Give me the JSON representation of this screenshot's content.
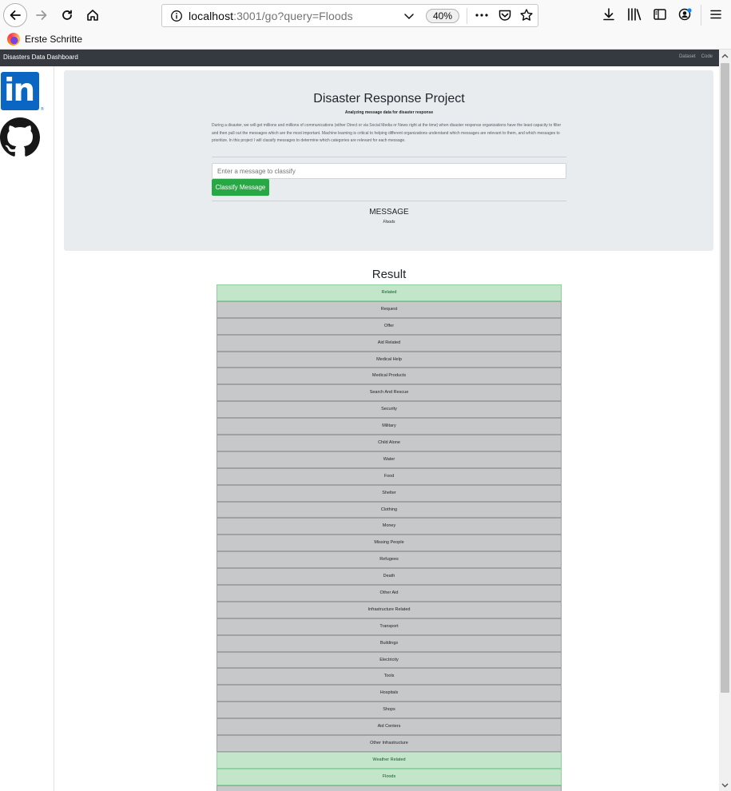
{
  "browser": {
    "url_host": "localhost",
    "url_path": ":3001/go?query=Floods",
    "zoom": "40%",
    "bookmark_label": "Erste Schritte"
  },
  "navbar": {
    "brand": "Disasters Data Dashboard",
    "links": [
      "Dataset",
      "Code"
    ]
  },
  "sidebar": {
    "linkedin_text": "in"
  },
  "jumbotron": {
    "title": "Disaster Response Project",
    "subtitle": "Analyzing message data for disaster response",
    "description": "During a disaster, we will get millions and millions of communications (either Direct or via Social Media or News right at the time) when disaster response organizations have the least capacity to filter and then pull out the messages which are the most important. Machine learning is critical to helping different organizations understand which messages are relevant to them, and which messages to prioritize. In this project I will classify messages to determine which categories are relevant for each message.",
    "input_placeholder": "Enter a message to classify",
    "button_label": "Classify Message",
    "message_label": "MESSAGE",
    "message_text": "Floods"
  },
  "result": {
    "title": "Result",
    "items": [
      {
        "label": "Related",
        "active": true
      },
      {
        "label": "Request",
        "active": false
      },
      {
        "label": "Offer",
        "active": false
      },
      {
        "label": "Aid Related",
        "active": false
      },
      {
        "label": "Medical Help",
        "active": false
      },
      {
        "label": "Medical Products",
        "active": false
      },
      {
        "label": "Search And Rescue",
        "active": false
      },
      {
        "label": "Security",
        "active": false
      },
      {
        "label": "Military",
        "active": false
      },
      {
        "label": "Child Alone",
        "active": false
      },
      {
        "label": "Water",
        "active": false
      },
      {
        "label": "Food",
        "active": false
      },
      {
        "label": "Shelter",
        "active": false
      },
      {
        "label": "Clothing",
        "active": false
      },
      {
        "label": "Money",
        "active": false
      },
      {
        "label": "Missing People",
        "active": false
      },
      {
        "label": "Refugees",
        "active": false
      },
      {
        "label": "Death",
        "active": false
      },
      {
        "label": "Other Aid",
        "active": false
      },
      {
        "label": "Infrastructure Related",
        "active": false
      },
      {
        "label": "Transport",
        "active": false
      },
      {
        "label": "Buildings",
        "active": false
      },
      {
        "label": "Electricity",
        "active": false
      },
      {
        "label": "Tools",
        "active": false
      },
      {
        "label": "Hospitals",
        "active": false
      },
      {
        "label": "Shops",
        "active": false
      },
      {
        "label": "Aid Centers",
        "active": false
      },
      {
        "label": "Other Infrastructure",
        "active": false
      },
      {
        "label": "Weather Related",
        "active": true
      },
      {
        "label": "Floods",
        "active": true
      },
      {
        "label": "",
        "active": false
      }
    ]
  },
  "colors": {
    "navbar": "#343a40",
    "jumbotron": "#e9ecef",
    "success": "#28a745",
    "active_row": "#c3e6cb",
    "inactive_row": "#c6c8ca"
  }
}
